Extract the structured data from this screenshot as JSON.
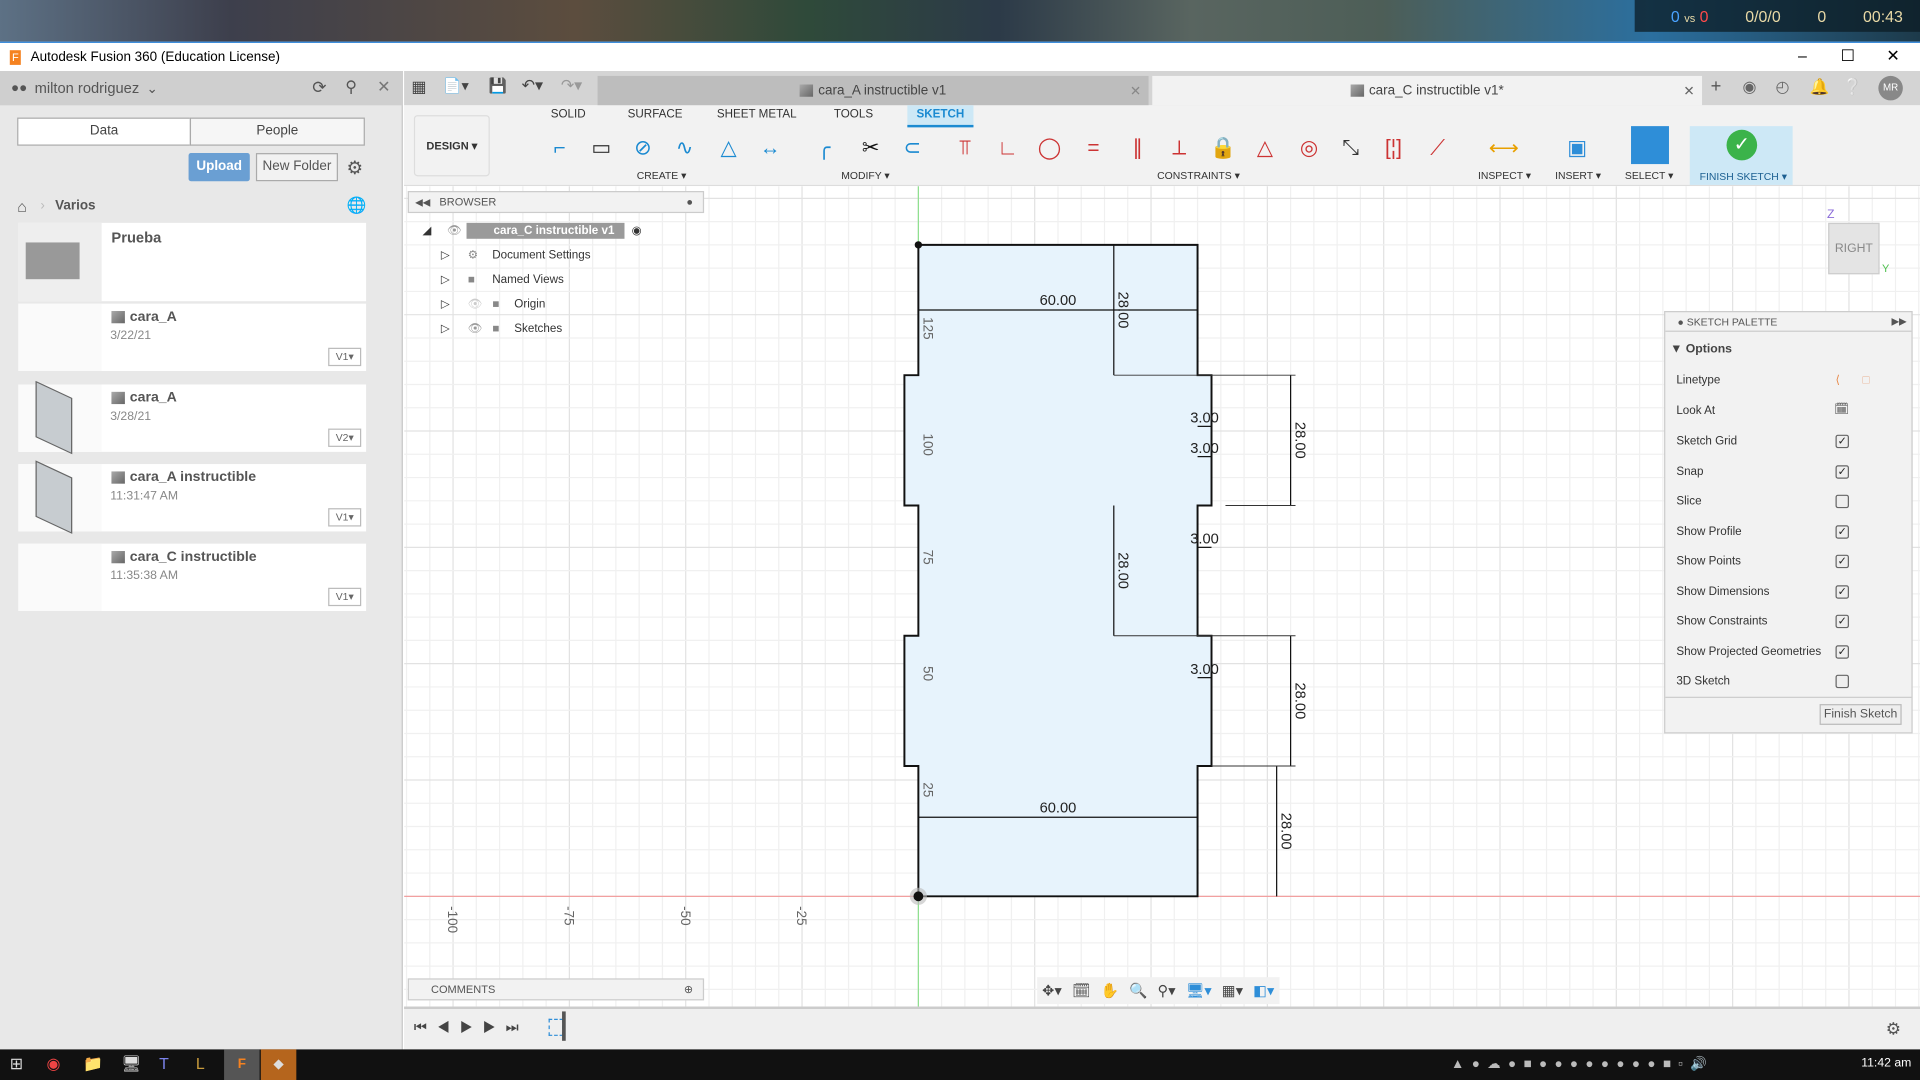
{
  "game_hud": {
    "score_blue": "0",
    "vs": "vs",
    "score_red": "0",
    "kda": "0/0/0",
    "gold": "0",
    "time": "00:43"
  },
  "window": {
    "title": "Autodesk Fusion 360 (Education License)",
    "minimize": "–",
    "maximize": "☐",
    "close": "✕"
  },
  "data_panel": {
    "user": "milton rodriguez",
    "tabs": [
      "Data",
      "People"
    ],
    "upload": "Upload",
    "new_folder": "New Folder",
    "breadcrumb": "Varios",
    "items": [
      {
        "name": "Prueba",
        "type": "folder"
      },
      {
        "name": "cara_A",
        "date": "3/22/21",
        "version": "V1"
      },
      {
        "name": "cara_A",
        "date": "3/28/21",
        "version": "V2"
      },
      {
        "name": "cara_A instructible",
        "date": "11:31:47 AM",
        "version": "V1"
      },
      {
        "name": "cara_C instructible",
        "date": "11:35:38 AM",
        "version": "V1"
      }
    ]
  },
  "doc_tabs": [
    {
      "label": "cara_A instructible v1",
      "active": false
    },
    {
      "label": "cara_C instructible v1*",
      "active": true
    }
  ],
  "user_initials": "MR",
  "toolbar": {
    "workspace": "DESIGN ▾",
    "tabs": [
      "SOLID",
      "SURFACE",
      "SHEET METAL",
      "TOOLS",
      "SKETCH"
    ],
    "active_tab": "SKETCH",
    "groups": {
      "create": "CREATE ▾",
      "modify": "MODIFY ▾",
      "constraints": "CONSTRAINTS ▾",
      "inspect": "INSPECT ▾",
      "insert": "INSERT ▾",
      "select": "SELECT ▾",
      "finish": "FINISH SKETCH ▾"
    }
  },
  "browser": {
    "title": "BROWSER",
    "root": "cara_C instructible v1",
    "nodes": [
      "Document Settings",
      "Named Views",
      "Origin",
      "Sketches"
    ]
  },
  "comments": "COMMENTS",
  "viewcube": {
    "face": "RIGHT",
    "z": "Z",
    "y": "Y"
  },
  "sketch": {
    "dims": {
      "width_top": "60.00",
      "width_bottom": "60.00",
      "d28": "28.00",
      "d3": "3.00"
    },
    "axis_labels_v": [
      "25",
      "50",
      "75",
      "100",
      "125"
    ],
    "axis_labels_h": [
      "-100",
      "-75",
      "-50",
      "-25"
    ],
    "accent": "#e7f3fc"
  },
  "palette": {
    "title": "SKETCH PALETTE",
    "section": "Options",
    "linetype": "Linetype",
    "look_at": "Look At",
    "options": [
      {
        "label": "Sketch Grid",
        "checked": true
      },
      {
        "label": "Snap",
        "checked": true
      },
      {
        "label": "Slice",
        "checked": false
      },
      {
        "label": "Show Profile",
        "checked": true
      },
      {
        "label": "Show Points",
        "checked": true
      },
      {
        "label": "Show Dimensions",
        "checked": true
      },
      {
        "label": "Show Constraints",
        "checked": true
      },
      {
        "label": "Show Projected Geometries",
        "checked": true
      },
      {
        "label": "3D Sketch",
        "checked": false
      }
    ],
    "finish": "Finish Sketch"
  },
  "taskbar": {
    "time": "11:42 am"
  }
}
